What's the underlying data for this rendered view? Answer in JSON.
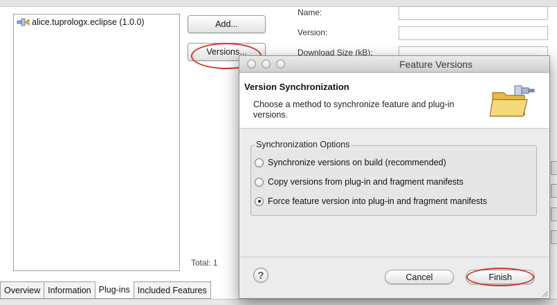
{
  "editor": {
    "plugin_item": "alice.tuprologx.eclipse (1.0.0)",
    "add_button": "Add...",
    "versions_button": "Versions...",
    "total": "Total: 1",
    "fields": {
      "name_label": "Name:",
      "version_label": "Version:",
      "download_label": "Download Size (kB):"
    },
    "tabs": [
      "Overview",
      "Information",
      "Plug-ins",
      "Included Features"
    ],
    "active_tab": "Plug-ins"
  },
  "dialog": {
    "title": "Feature Versions",
    "header_title": "Version Synchronization",
    "header_desc": "Choose a method to synchronize feature and plug-in versions.",
    "group_title": "Synchronization Options",
    "options": [
      "Synchronize versions on build (recommended)",
      "Copy versions from plug-in and fragment manifests",
      "Force feature version into plug-in and fragment manifests"
    ],
    "selected_option_index": 2,
    "help_label": "?",
    "cancel_button": "Cancel",
    "finish_button": "Finish"
  },
  "colors": {
    "annotation_red": "#d2372c",
    "folder_yellow": "#f0c95a"
  },
  "icons": {
    "plugin_icon": "plugin-icon",
    "folder_icon": "folder-plug-icon",
    "help_icon": "help-icon"
  }
}
